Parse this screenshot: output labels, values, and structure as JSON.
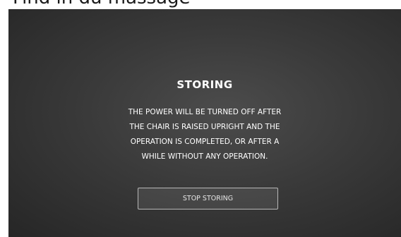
{
  "header": {
    "caption": "Find in du massage"
  },
  "dialog": {
    "title": "STORING",
    "message_lines": [
      "THE POWER WILL BE TURNED OFF AFTER",
      "THE CHAIR IS RAISED UPRIGHT AND THE",
      "OPERATION IS COMPLETED, OR AFTER A",
      "WHILE WITHOUT ANY OPERATION."
    ],
    "stop_button_label": "STOP STORING"
  },
  "colors": {
    "background": "#333333",
    "text": "#ffffff",
    "button_border": "#b8b8b8"
  }
}
